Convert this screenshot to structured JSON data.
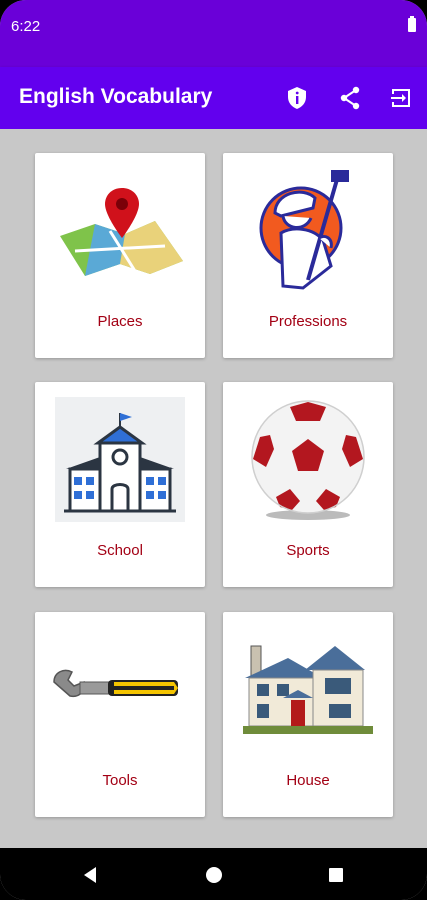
{
  "status": {
    "time": "6:22"
  },
  "app": {
    "title": "English Vocabulary"
  },
  "toolbar": {
    "icons": [
      "info-shield-icon",
      "share-icon",
      "exit-icon"
    ]
  },
  "categories": [
    {
      "label": "Places",
      "icon": "map-pin-icon"
    },
    {
      "label": "Professions",
      "icon": "worker-icon"
    },
    {
      "label": "School",
      "icon": "school-building-icon"
    },
    {
      "label": "Sports",
      "icon": "soccer-ball-icon"
    },
    {
      "label": "Tools",
      "icon": "wrench-icon"
    },
    {
      "label": "House",
      "icon": "house-icon"
    }
  ],
  "nav": {
    "icons": [
      "back-icon",
      "home-icon",
      "recents-icon"
    ]
  },
  "colors": {
    "statusbar": "#6a00d8",
    "appbar": "#6200ee",
    "label": "#a30014",
    "background": "#c8c8c8"
  }
}
